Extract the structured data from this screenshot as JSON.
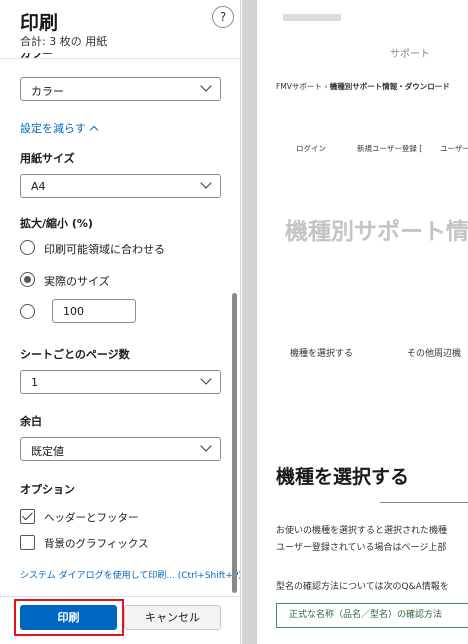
{
  "panel": {
    "title": "印刷",
    "subtitle": "合計: 3 枚の 用紙",
    "help_label": "?",
    "color_section_label": "カラー",
    "color_value": "カラー",
    "fewer_settings_link": "設定を減らす",
    "paper_size_label": "用紙サイズ",
    "paper_size_value": "A4",
    "scale_label": "拡大/縮小 (%)",
    "scale_options": [
      "印刷可能領域に合わせる",
      "実際のサイズ"
    ],
    "scale_selected": "実際のサイズ",
    "scale_custom_value": "100",
    "pages_per_sheet_label": "シートごとのページ数",
    "pages_per_sheet_value": "1",
    "margins_label": "余白",
    "margins_value": "既定値",
    "options_label": "オプション",
    "option_headers_footers": "ヘッダーとフッター",
    "option_headers_footers_checked": true,
    "option_background_graphics": "背景のグラフィックス",
    "option_background_graphics_checked": false,
    "system_dialog_link": "システム ダイアログを使用して印刷... (Ctrl+Shift+P)",
    "print_button": "印刷",
    "cancel_button": "キャンセル"
  },
  "preview": {
    "site_section": "サポート",
    "breadcrumb_root": "FMVサポート",
    "breadcrumb_separator": "›",
    "breadcrumb_current": "機種別サポート情報・ダウンロード",
    "nav_login": "ログイン",
    "nav_register": "新規ユーザー登録 [",
    "nav_user": "ユーザー",
    "hero_title": "機種別サポート情",
    "menu_select_model": "機種を選択する",
    "menu_other": "その他周辺機",
    "section_title": "機種を選択する",
    "paragraph_1": "お使いの機種を選択すると選択された機種",
    "paragraph_2": "ユーザー登録されている場合はページ上部",
    "paragraph_3": "型名の確認方法については次のQ&A情報を",
    "confirm_button": "正式な名称（品名／型名）の確認方法"
  },
  "colors": {
    "accent": "#0067c0",
    "highlight_box": "#e0141e",
    "preview_link_border": "#4a8a5a"
  }
}
